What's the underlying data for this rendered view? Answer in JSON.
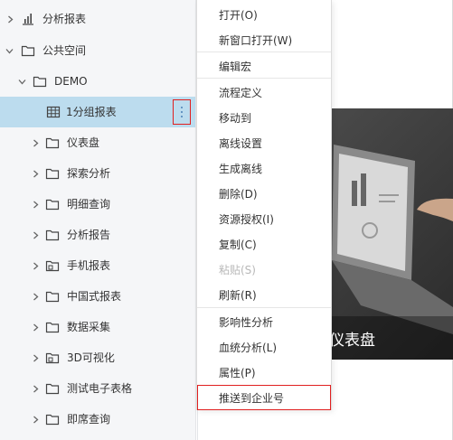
{
  "tree": {
    "items": [
      {
        "label": "分析报表",
        "icon": "bar-chart-icon"
      },
      {
        "label": "公共空间",
        "icon": "folder-icon"
      },
      {
        "label": "DEMO",
        "icon": "folder-icon"
      },
      {
        "label": "1分组报表",
        "icon": "table-icon"
      },
      {
        "label": "仪表盘",
        "icon": "folder-icon"
      },
      {
        "label": "探索分析",
        "icon": "folder-icon"
      },
      {
        "label": "明细查询",
        "icon": "folder-icon"
      },
      {
        "label": "分析报告",
        "icon": "folder-icon"
      },
      {
        "label": "手机报表",
        "icon": "folder-lock-icon"
      },
      {
        "label": "中国式报表",
        "icon": "folder-icon"
      },
      {
        "label": "数据采集",
        "icon": "folder-icon"
      },
      {
        "label": "3D可视化",
        "icon": "folder-lock-icon"
      },
      {
        "label": "测试电子表格",
        "icon": "folder-icon"
      },
      {
        "label": "即席查询",
        "icon": "folder-icon"
      }
    ],
    "more_button_icon": "more-vertical-icon"
  },
  "context_menu": {
    "items": [
      {
        "label": "打开(O)",
        "disabled": false
      },
      {
        "label": "新窗口打开(W)",
        "disabled": false
      },
      {
        "label": "编辑宏",
        "disabled": false
      },
      {
        "label": "流程定义",
        "disabled": false
      },
      {
        "label": "移动到",
        "disabled": false
      },
      {
        "label": "离线设置",
        "disabled": false
      },
      {
        "label": "生成离线",
        "disabled": false
      },
      {
        "label": "删除(D)",
        "disabled": false
      },
      {
        "label": "资源授权(I)",
        "disabled": false
      },
      {
        "label": "复制(C)",
        "disabled": false
      },
      {
        "label": "粘贴(S)",
        "disabled": true
      },
      {
        "label": "刷新(R)",
        "disabled": false
      },
      {
        "label": "影响性分析",
        "disabled": false
      },
      {
        "label": "血统分析(L)",
        "disabled": false
      },
      {
        "label": "属性(P)",
        "disabled": false
      },
      {
        "label": "推送到企业号",
        "disabled": false
      }
    ]
  },
  "preview": {
    "caption": "的仪表盘"
  },
  "colors": {
    "selected_row": "#bcdcee",
    "highlight_border": "#e02020",
    "tree_bg": "#f5f6f8",
    "disabled_text": "#b8b8b8"
  }
}
